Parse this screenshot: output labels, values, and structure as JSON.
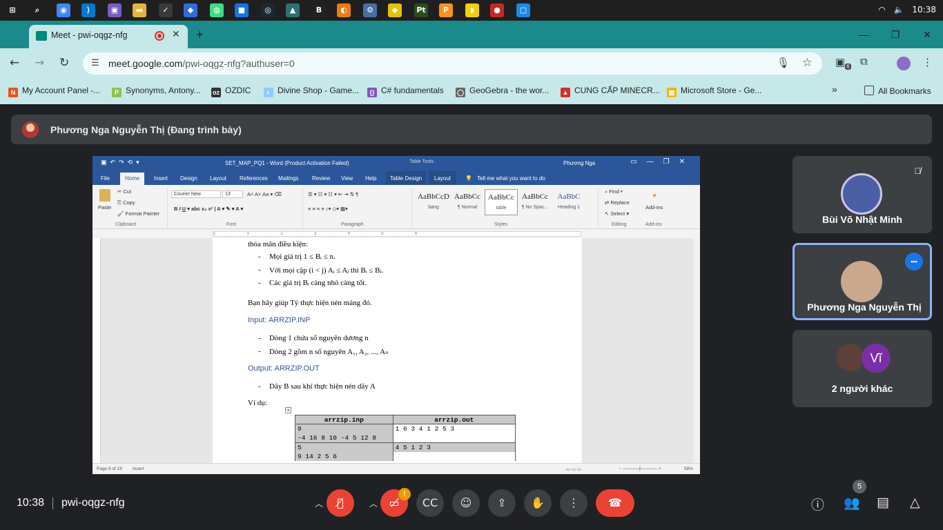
{
  "taskbar": {
    "time": "10:38",
    "wifi_icon": "wifi-icon",
    "volume_icon": "volume-icon",
    "apps": [
      {
        "name": "start",
        "glyph": "⊞",
        "color": "#1f1f1f"
      },
      {
        "name": "search",
        "glyph": "⌕",
        "color": "#1f1f1f"
      },
      {
        "name": "chrome",
        "glyph": "◉",
        "color": "#4285f4"
      },
      {
        "name": "vscode",
        "glyph": "⟩",
        "color": "#0078d4"
      },
      {
        "name": "app",
        "glyph": "▣",
        "color": "#7a5cc2"
      },
      {
        "name": "files",
        "glyph": "▬",
        "color": "#e8b339"
      },
      {
        "name": "tasks",
        "glyph": "✓",
        "color": "#3a3a3a"
      },
      {
        "name": "app",
        "glyph": "◆",
        "color": "#2d6cdf"
      },
      {
        "name": "android",
        "glyph": "◍",
        "color": "#3ddc84"
      },
      {
        "name": "app",
        "glyph": "■",
        "color": "#1473e6"
      },
      {
        "name": "steam",
        "glyph": "◎",
        "color": "#1b2838"
      },
      {
        "name": "app",
        "glyph": "▲",
        "color": "#2f6f6f"
      },
      {
        "name": "app",
        "glyph": "B",
        "color": "#222"
      },
      {
        "name": "blender",
        "glyph": "◐",
        "color": "#e87d0d"
      },
      {
        "name": "app",
        "glyph": "⚙",
        "color": "#4a6fa5"
      },
      {
        "name": "app",
        "glyph": "◆",
        "color": "#e6c200"
      },
      {
        "name": "pt",
        "glyph": "Pt",
        "color": "#2d4a1c"
      },
      {
        "name": "app",
        "glyph": "P",
        "color": "#f7931e"
      },
      {
        "name": "app",
        "glyph": "◗",
        "color": "#f5d000"
      },
      {
        "name": "app",
        "glyph": "●",
        "color": "#c62828"
      },
      {
        "name": "app",
        "glyph": "▢",
        "color": "#1e88e5"
      }
    ]
  },
  "browser": {
    "tab_title": "Meet - pwi-oqgz-nfg",
    "tab_close": "✕",
    "new_tab": "+",
    "window_controls": [
      "—",
      "❐",
      "✕"
    ],
    "url_host": "meet.google.com",
    "url_path": "/pwi-oqgz-nfg?authuser=0",
    "ext_badge": "6",
    "bookmarks": [
      {
        "label": "My Account Panel -...",
        "color": "#e8541f",
        "glyph": "N"
      },
      {
        "label": "Synonyms, Antony...",
        "color": "#8bc34a",
        "glyph": "P"
      },
      {
        "label": "OZDIC",
        "color": "#333333",
        "glyph": "oz"
      },
      {
        "label": "Divine Shop - Game...",
        "color": "#90caf9",
        "glyph": "◐"
      },
      {
        "label": "C# fundamentals",
        "color": "#7e57c2",
        "glyph": "{}"
      },
      {
        "label": "GeoGebra - the wor...",
        "color": "#666666",
        "glyph": "◯"
      },
      {
        "label": "CUNG CẤP MINECR...",
        "color": "#d32f2f",
        "glyph": "▲"
      },
      {
        "label": "Microsoft Store - Ge...",
        "color": "#ffb300",
        "glyph": "▦"
      }
    ],
    "bookmarks_more": "»",
    "all_bookmarks": "All Bookmarks"
  },
  "meet": {
    "presenter_banner": "Phương Nga Nguyễn Thị (Đang trình bày)",
    "meeting_time": "10:38",
    "meeting_code": "pwi-oqgz-nfg",
    "participant_count": "5",
    "tiles": [
      {
        "name": "Bùi Võ Nhật Minh",
        "muted": true
      },
      {
        "name": "Phương Nga Nguyễn Thị",
        "active": true
      },
      {
        "name": "2 người khác",
        "extra_initial": "Vĩ"
      }
    ],
    "more_dots": "•••",
    "cam_warning": "!"
  },
  "word": {
    "doc_title": "SET_MAP_PQ1 - Word (Product Activation Failed)",
    "table_tools": "Table Tools",
    "user": "Phương Nga",
    "tabs": [
      "File",
      "Home",
      "Insert",
      "Design",
      "Layout",
      "References",
      "Mailings",
      "Review",
      "View",
      "Help",
      "Table Design",
      "Layout"
    ],
    "tell_me": "Tell me what you want to do",
    "clipboard": {
      "paste": "Paste",
      "cut": "Cut",
      "copy": "Copy",
      "format_painter": "Format Painter",
      "label": "Clipboard"
    },
    "font": {
      "name": "Courier New",
      "size": "13",
      "label": "Font"
    },
    "paragraph_label": "Paragraph",
    "styles": [
      {
        "sample": "AaBbCcD",
        "name": "bang"
      },
      {
        "sample": "AaBbCc",
        "name": "¶ Normal"
      },
      {
        "sample": "AaBbCc",
        "name": "table"
      },
      {
        "sample": "AaBbCc",
        "name": "¶ No Spac..."
      },
      {
        "sample": "AaBbC",
        "name": "Heading 1"
      }
    ],
    "styles_label": "Styles",
    "editing": {
      "find": "Find",
      "replace": "Replace",
      "select": "Select",
      "label": "Editing"
    },
    "addins": {
      "btn": "Add-ins",
      "label": "Add-ins"
    },
    "ruler_marks": "1 · 1 · 2 · 3 · 4 · 5 · 6",
    "status": {
      "page": "Page 8 of 19",
      "mode": "Insert",
      "zoom": "58%"
    },
    "document": {
      "intro": "thỏa mãn điều kiện:",
      "conditions": [
        "Mọi giá trị 1 ≤ Bᵢ ≤ n.",
        "Với mọi cặp (i < j) Aᵢ ≤ Aⱼ thì Bᵢ ≤ Bⱼ.",
        "Các giá trị Bᵢ càng nhỏ càng tốt."
      ],
      "request": "Bạn hãy giúp Tý thực hiện nén mảng đó.",
      "input_heading": "Input: ARRZIP.INP",
      "input_items": [
        "Dòng 1 chứa số nguyên dương n",
        "Dòng 2 gồm n số nguyên A₁, A₂, ..., Aₙ"
      ],
      "output_heading": "Output: ARRZIP.OUT",
      "output_items": [
        "Dãy B sau khi thực hiện nén dãy A"
      ],
      "example_label": "Ví dụ:",
      "dash": "-",
      "table": {
        "headers": [
          "arrzip.inp",
          "arrzip.out"
        ],
        "rows": [
          {
            "inp": "9",
            "out": "1 6 3 4 1 2 5 3"
          },
          {
            "inp": "-4 16 8 10 -4 5 12 8",
            "out": ""
          },
          {
            "inp": "5",
            "out": "4 5 1 2 3"
          },
          {
            "inp": "9 14 2 5 6",
            "out": ""
          }
        ]
      }
    }
  }
}
